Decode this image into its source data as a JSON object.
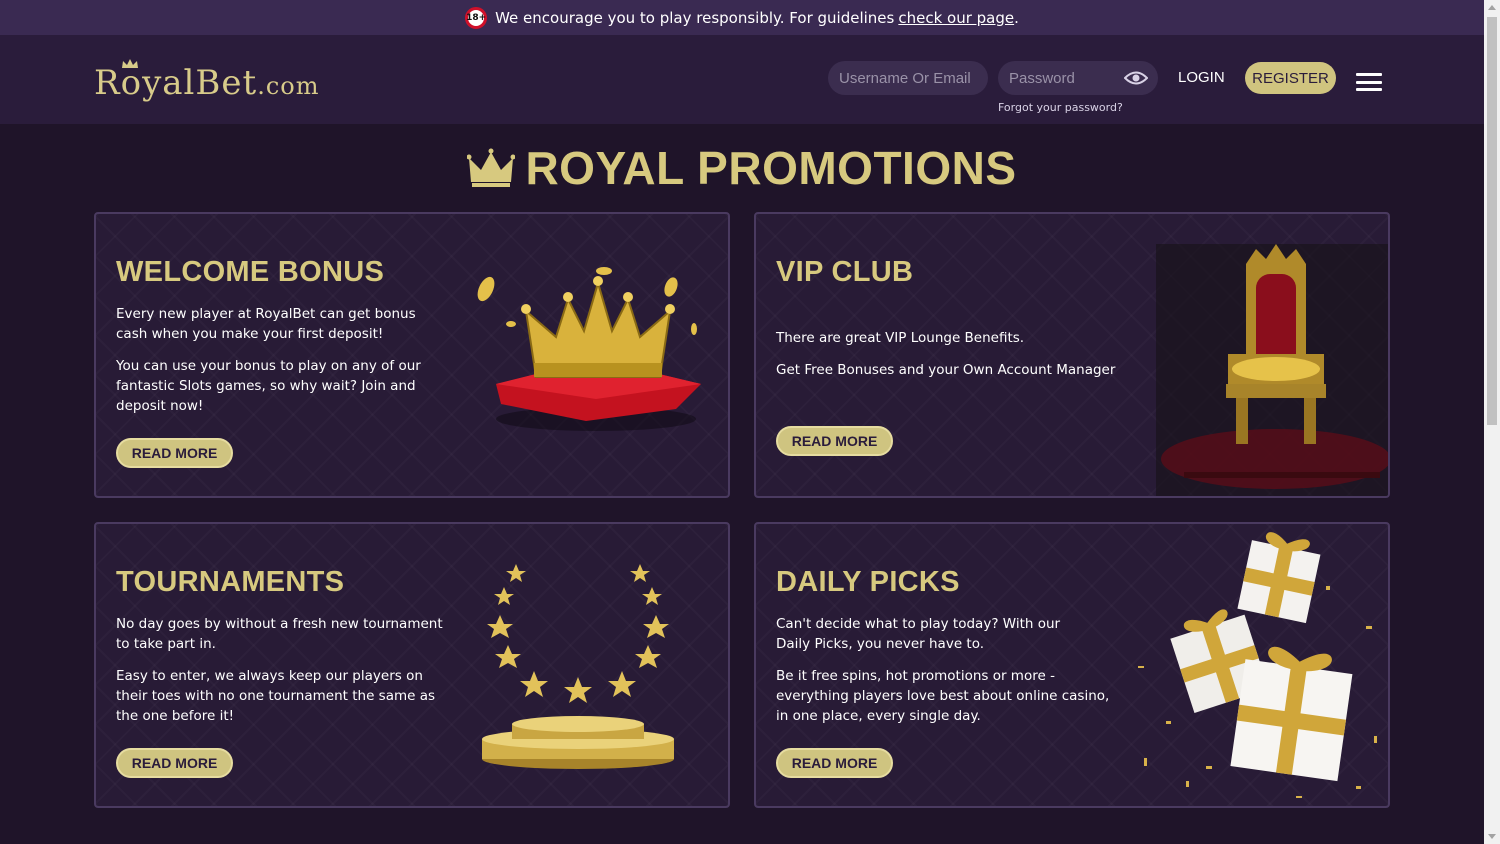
{
  "notice": {
    "age_badge": "18+",
    "text": "We encourage you to play responsibly. For guidelines",
    "link": "check our page",
    "period": "."
  },
  "header": {
    "logo_main": "RoyalBet",
    "logo_suffix": ".com",
    "username_placeholder": "Username Or Email",
    "password_placeholder": "Password",
    "forgot": "Forgot your password?",
    "login": "LOGIN",
    "register": "REGISTER"
  },
  "page_title": "ROYAL PROMOTIONS",
  "cards": [
    {
      "title": "WELCOME BONUS",
      "paragraphs": [
        "Every new player at RoyalBet can get bonus cash when you make your first deposit!",
        "You can use your bonus to play on any of our fantastic Slots games, so why wait? Join and deposit now!"
      ],
      "button": "READ MORE",
      "image": "crown-on-cushion"
    },
    {
      "title": "VIP CLUB",
      "paragraphs": [
        "There are great VIP Lounge Benefits.",
        "Get Free Bonuses and your Own Account Manager"
      ],
      "button": "READ MORE",
      "image": "golden-throne"
    },
    {
      "title": "TOURNAMENTS",
      "paragraphs": [
        "No day goes by without a fresh new tournament to take part in.",
        "Easy to enter, we always keep our players on their toes with no one tournament the same as the one before it!"
      ],
      "button": "READ MORE",
      "image": "stars-podium"
    },
    {
      "title": "DAILY PICKS",
      "paragraphs": [
        "Can't decide what to play today? With our Daily Picks, you never have to.",
        "Be it free spins, hot promotions or more - everything players love best about online casino, in one place, every single day."
      ],
      "button": "READ MORE",
      "image": "gift-boxes"
    }
  ],
  "colors": {
    "background": "#1f1429",
    "header": "#2a1c3b",
    "gold": "#d7c97f",
    "card": "#281b36"
  }
}
